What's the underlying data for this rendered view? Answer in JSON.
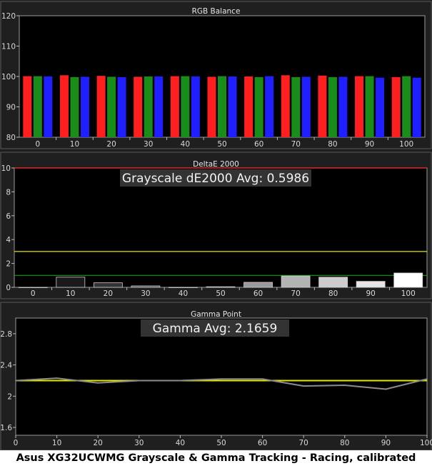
{
  "caption": "Asus XG32UCWMG Grayscale & Gamma Tracking - Racing, calibrated",
  "colors": {
    "red": "#ff1f1f",
    "green": "#1a8c1a",
    "blue": "#1f1fff",
    "line_yellow": "#e6e600",
    "line_green": "#1a9c1a",
    "line_red": "#ff3030",
    "gamma_line": "#8c8c8c"
  },
  "chart_data": [
    {
      "type": "bar",
      "title": "RGB Balance",
      "categories": [
        "0",
        "10",
        "20",
        "30",
        "40",
        "50",
        "60",
        "70",
        "80",
        "90",
        "100"
      ],
      "series": [
        {
          "color": "red",
          "values": [
            100.1,
            100.4,
            100.2,
            99.9,
            100.1,
            99.9,
            100.0,
            100.4,
            100.3,
            100.1,
            99.8
          ]
        },
        {
          "color": "green",
          "values": [
            100.1,
            99.8,
            99.9,
            100.0,
            100.1,
            100.1,
            99.8,
            99.8,
            99.8,
            100.1,
            100.1
          ]
        },
        {
          "color": "blue",
          "values": [
            100.0,
            99.9,
            99.8,
            100.0,
            100.0,
            100.0,
            100.1,
            99.9,
            99.9,
            99.6,
            99.6
          ]
        }
      ],
      "ylim": [
        80,
        120
      ],
      "yticks": [
        "80",
        "90",
        "100",
        "110",
        "120"
      ],
      "grid": false
    },
    {
      "type": "bar",
      "title": "DeltaE 2000",
      "annotation": "Grayscale dE2000 Avg: 0.5986",
      "categories": [
        "0",
        "10",
        "20",
        "30",
        "40",
        "50",
        "60",
        "70",
        "80",
        "90",
        "100"
      ],
      "values": [
        0.0,
        0.85,
        0.38,
        0.12,
        0.0,
        0.05,
        0.42,
        0.95,
        0.85,
        0.5,
        1.2
      ],
      "bar_shades": [
        "#000000",
        "#1a1a1a",
        "#333333",
        "#4d4d4d",
        "#666666",
        "#808080",
        "#999999",
        "#b3b3b3",
        "#cccccc",
        "#e6e6e6",
        "#ffffff"
      ],
      "reference_lines": [
        {
          "value": 10,
          "color": "line_red"
        },
        {
          "value": 3,
          "color": "line_yellow"
        },
        {
          "value": 1,
          "color": "line_green"
        }
      ],
      "ylim": [
        0,
        10
      ],
      "yticks": [
        "0",
        "2",
        "4",
        "6",
        "8",
        "10"
      ],
      "grid": false
    },
    {
      "type": "line",
      "title": "Gamma Point",
      "annotation": "Gamma Avg: 2.1659",
      "x": [
        0,
        10,
        20,
        30,
        40,
        50,
        60,
        70,
        80,
        90,
        100
      ],
      "values": [
        2.2,
        2.23,
        2.17,
        2.2,
        2.2,
        2.22,
        2.22,
        2.13,
        2.14,
        2.09,
        2.22
      ],
      "target": 2.2,
      "xticks": [
        "0",
        "10",
        "20",
        "30",
        "40",
        "50",
        "60",
        "70",
        "80",
        "90",
        "100"
      ],
      "ylim": [
        1.5,
        3.0
      ],
      "yticks": [
        "1.6",
        "2",
        "2.4",
        "2.8"
      ],
      "grid": false
    }
  ]
}
